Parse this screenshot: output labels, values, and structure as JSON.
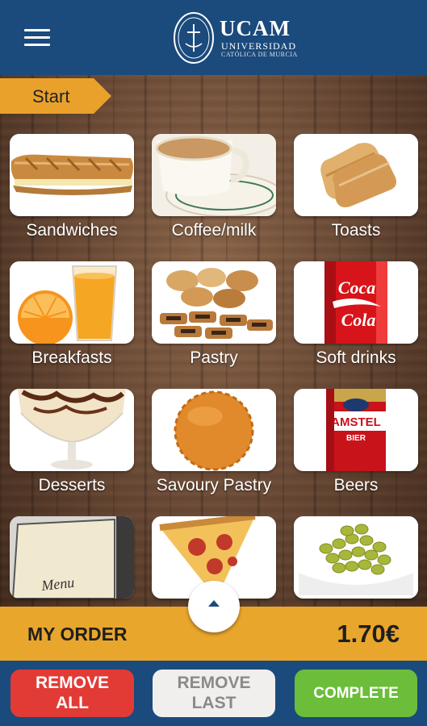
{
  "header": {
    "logo_main": "UCAM",
    "logo_sub1": "UNIVERSIDAD",
    "logo_sub2": "CATÓLICA DE MURCIA"
  },
  "breadcrumb": {
    "label": "Start"
  },
  "categories": [
    {
      "label": "Sandwiches",
      "icon": "baguette-image"
    },
    {
      "label": "Coffee/milk",
      "icon": "coffee-cup-image"
    },
    {
      "label": "Toasts",
      "icon": "toast-image"
    },
    {
      "label": "Breakfasts",
      "icon": "orange-juice-image"
    },
    {
      "label": "Pastry",
      "icon": "pastry-image"
    },
    {
      "label": "Soft drinks",
      "icon": "cola-can-image"
    },
    {
      "label": "Desserts",
      "icon": "ice-cream-image"
    },
    {
      "label": "Savoury Pastry",
      "icon": "pie-image"
    },
    {
      "label": "Beers",
      "icon": "beer-can-image"
    },
    {
      "label": "",
      "icon": "menu-board-image"
    },
    {
      "label": "",
      "icon": "pizza-image"
    },
    {
      "label": "",
      "icon": "olives-image"
    }
  ],
  "order": {
    "title": "MY ORDER",
    "total": "1.70€"
  },
  "actions": {
    "remove_all": "REMOVE\nALL",
    "remove_last": "REMOVE\nLAST",
    "complete": "COMPLETE"
  },
  "colors": {
    "header": "#1b4a7c",
    "accent_orange": "#e9a62c",
    "remove_all": "#e23b35",
    "remove_last": "#f1efed",
    "complete": "#6bbd3a"
  }
}
